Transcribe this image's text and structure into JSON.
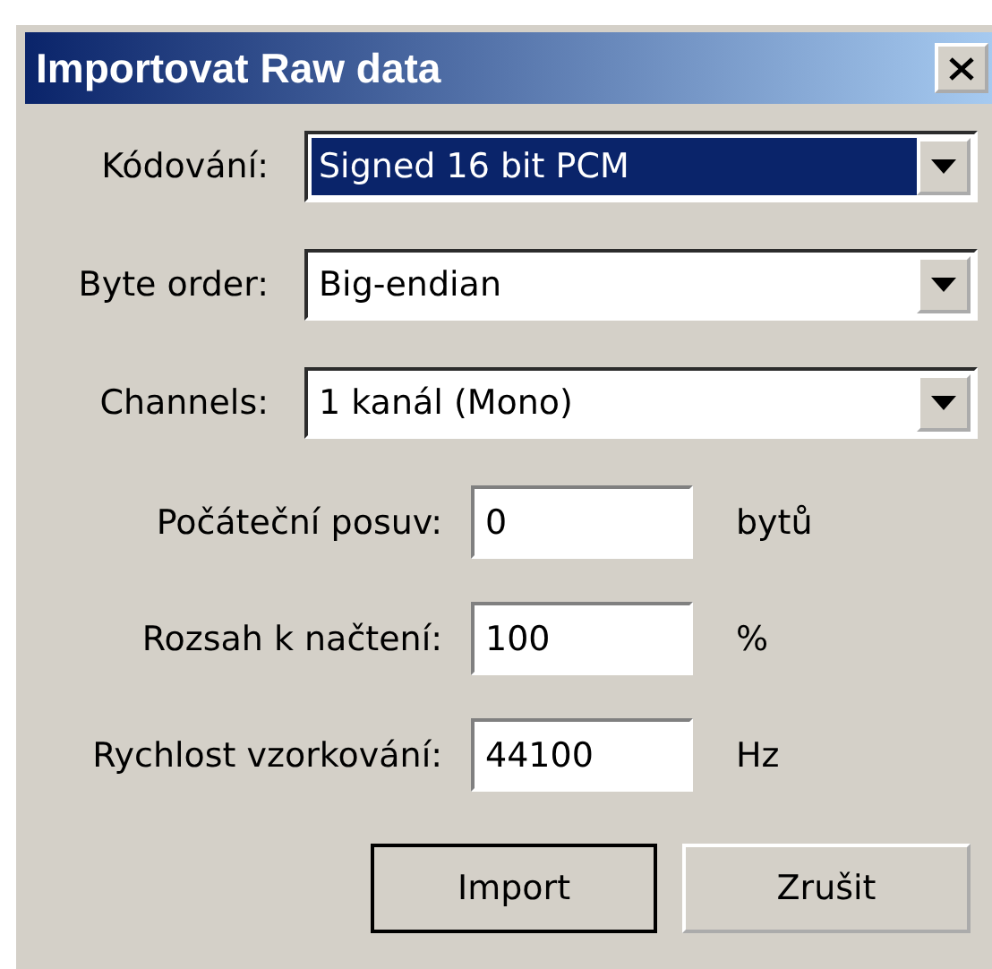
{
  "window": {
    "title": "Importovat Raw data"
  },
  "dropdowns": [
    {
      "label": "Kódování:",
      "value": "Signed 16 bit PCM",
      "focused": true
    },
    {
      "label": "Byte order:",
      "value": "Big-endian",
      "focused": false
    },
    {
      "label": "Channels:",
      "value": "1 kanál (Mono)",
      "focused": false
    }
  ],
  "fields": [
    {
      "label": "Počáteční posuv:",
      "value": "0",
      "unit": "bytů"
    },
    {
      "label": "Rozsah k načtení:",
      "value": "100",
      "unit": "%"
    },
    {
      "label": "Rychlost vzorkování:",
      "value": "44100",
      "unit": "Hz"
    }
  ],
  "buttons": [
    {
      "label": "Import",
      "default": true
    },
    {
      "label": "Zrušit",
      "default": false
    }
  ]
}
